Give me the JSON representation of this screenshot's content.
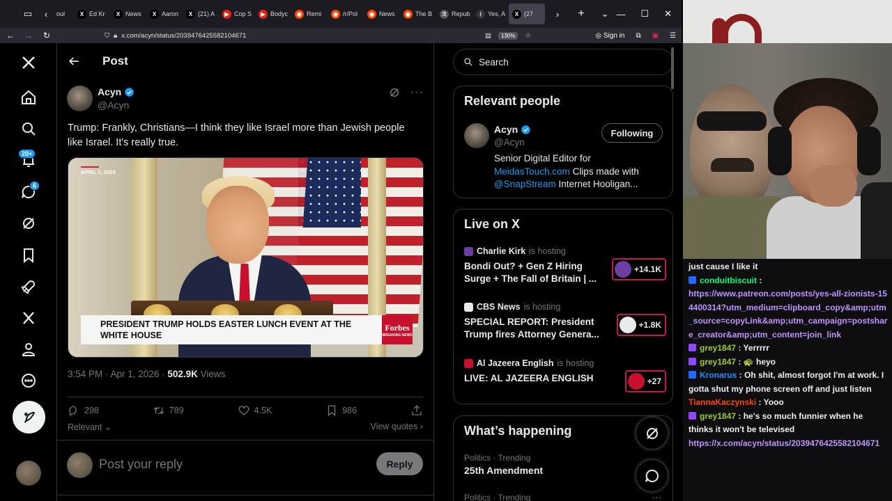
{
  "browser": {
    "tabs": [
      {
        "label": "oul",
        "fav": "",
        "color": "#555"
      },
      {
        "label": "Ed Kr",
        "fav": "X",
        "color": "#000"
      },
      {
        "label": "News",
        "fav": "X",
        "color": "#000"
      },
      {
        "label": "Aaron",
        "fav": "X",
        "color": "#000"
      },
      {
        "label": "(21) A",
        "fav": "X",
        "color": "#000"
      },
      {
        "label": "Cop S",
        "fav": "▶",
        "color": "#e62117"
      },
      {
        "label": "Bodyc",
        "fav": "▶",
        "color": "#e62117"
      },
      {
        "label": "Remi",
        "fav": "◉",
        "color": "#ff4500"
      },
      {
        "label": "/r/Pol",
        "fav": "◉",
        "color": "#ff4500"
      },
      {
        "label": "News",
        "fav": "◉",
        "color": "#ff4500"
      },
      {
        "label": "The B",
        "fav": "◉",
        "color": "#ff4500"
      },
      {
        "label": "Repub",
        "fav": "ℛ",
        "color": "#555"
      },
      {
        "label": "Yes, A",
        "fav": "ᚮ",
        "color": "#333"
      },
      {
        "label": "(27",
        "fav": "X",
        "color": "#000"
      }
    ],
    "url": "x.com/acyn/status/2039476425582104671",
    "zoom": "130%",
    "sign_in": "Sign in"
  },
  "nav": {
    "notifications_badge": "20+",
    "messages_badge": "6"
  },
  "post": {
    "header_title": "Post",
    "author_name": "Acyn",
    "author_handle": "@Acyn",
    "text": "Trump: Frankly, Christians—I think they like Israel more than Jewish people like Israel. It's really true.",
    "media": {
      "date_tag": "APRIL 1, 2026",
      "lower_third": "PRESIDENT TRUMP HOLDS EASTER LUNCH EVENT AT THE WHITE HOUSE",
      "brand": "Forbes",
      "brand_sub": "BREAKING NEWS"
    },
    "time": "3:54 PM · Apr 1, 2026 · ",
    "views_count": "502.9K",
    "views_label": "Views",
    "replies": "298",
    "reposts": "789",
    "likes": "4.5K",
    "bookmarks": "986",
    "sort_label": "Relevant",
    "view_quotes": "View quotes",
    "reply_placeholder": "Post your reply",
    "reply_button": "Reply"
  },
  "sidebar": {
    "search_placeholder": "Search",
    "relevant_people": {
      "title": "Relevant people",
      "name": "Acyn",
      "handle": "@Acyn",
      "follow_label": "Following",
      "bio_1": "Senior Digital Editor for",
      "bio_link_1": "MeidasTouch.com",
      "bio_2": " Clips made with",
      "bio_link_2": "@SnapStream",
      "bio_3": " Internet Hooligan..."
    },
    "live": {
      "title": "Live on X",
      "items": [
        {
          "host": "Charlie Kirk",
          "suffix": "is hosting",
          "title": "Bondi Out? + Gen Z Hiring Surge + The Fall of Britain | ...",
          "count": "+14.1K",
          "color": "#6b3fa0"
        },
        {
          "host": "CBS News",
          "suffix": "is hosting",
          "title": "SPECIAL REPORT: President Trump fires Attorney Genera...",
          "count": "+1.8K",
          "color": "#e7e9ea"
        },
        {
          "host": "Al Jazeera English",
          "suffix": "is hosting",
          "title": "LIVE: AL JAZEERA ENGLISH",
          "count": "+27",
          "color": "#c8102e"
        }
      ]
    },
    "happening": {
      "title": "What’s happening",
      "trends": [
        {
          "meta": "Politics · Trending",
          "name": "25th Amendment"
        },
        {
          "meta": "Politics · Trending",
          "name": ""
        }
      ]
    }
  },
  "chat": {
    "lines": [
      {
        "user": "",
        "user_color": "#efeff1",
        "badge": "",
        "msg": "just cause I like it"
      },
      {
        "user": "conduitbiscuit",
        "user_color": "#00ff7f",
        "badge": "#1f69ff",
        "msg": " :"
      },
      {
        "user": "",
        "user_color": "#bf94ff",
        "badge": "",
        "msg": "",
        "link": "https://www.patreon.com/posts/yes-all-zionists-154400314?utm_medium=clipboard_copy&amp;utm_source=copyLink&amp;utm_campaign=postshare_creator&amp;utm_content=join_link"
      },
      {
        "user": "grey1847",
        "user_color": "#9acd32",
        "badge": "#9146ff",
        "msg": " : Yerrrrr"
      },
      {
        "user": "grey1847",
        "user_color": "#9acd32",
        "badge": "#9146ff",
        "msg": " : 🐢 heyo"
      },
      {
        "user": "Kronarus",
        "user_color": "#1e90ff",
        "badge": "#1f69ff",
        "msg": " : Oh shit, almost forgot I'm at work. I gotta shut my phone screen off and just listen"
      },
      {
        "user": "TiannaKaczynski",
        "user_color": "#ff4500",
        "badge": "",
        "msg": " : Yooo"
      },
      {
        "user": "grey1847",
        "user_color": "#9acd32",
        "badge": "#9146ff",
        "msg": " : he's so much funnier when he thinks it won't be televised"
      },
      {
        "user": "",
        "user_color": "#bf94ff",
        "badge": "",
        "msg": "",
        "link": "https://x.com/acyn/status/2039476425582104671"
      }
    ]
  },
  "colors": {
    "accent": "#1d9bf0",
    "text": "#e7e9ea",
    "muted": "#71767b",
    "border": "#2f3336"
  }
}
